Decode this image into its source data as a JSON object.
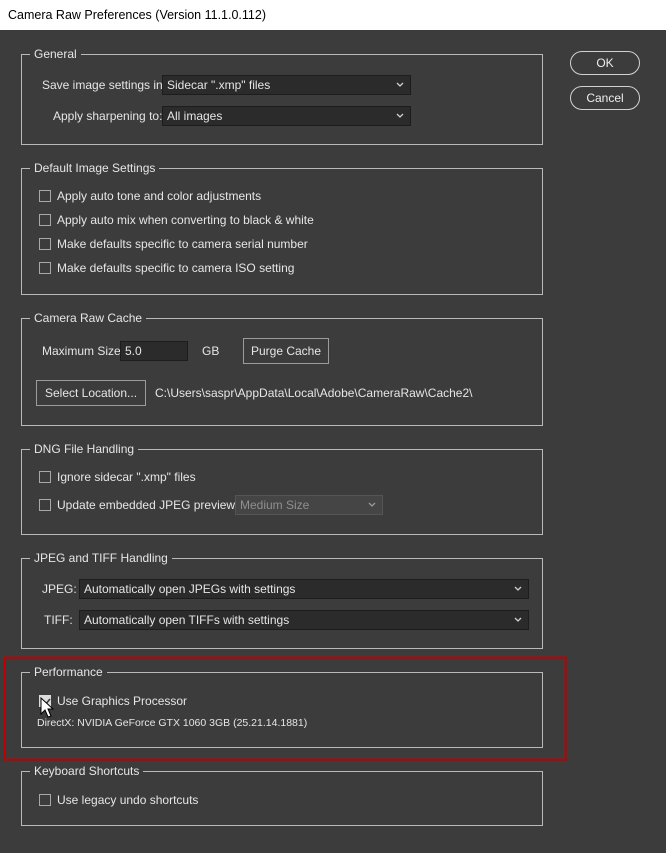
{
  "window": {
    "title": "Camera Raw Preferences  (Version 11.1.0.112)"
  },
  "buttons": {
    "ok": "OK",
    "cancel": "Cancel"
  },
  "general": {
    "legend": "General",
    "save_label": "Save image settings in:",
    "save_value": "Sidecar \".xmp\" files",
    "sharpen_label": "Apply sharpening to:",
    "sharpen_value": "All images"
  },
  "default_settings": {
    "legend": "Default Image Settings",
    "options": [
      {
        "label": "Apply auto tone and color adjustments",
        "checked": false
      },
      {
        "label": "Apply auto mix when converting to black & white",
        "checked": false
      },
      {
        "label": "Make defaults specific to camera serial number",
        "checked": false
      },
      {
        "label": "Make defaults specific to camera ISO setting",
        "checked": false
      }
    ]
  },
  "cache": {
    "legend": "Camera Raw Cache",
    "max_size_label": "Maximum Size:",
    "max_size_value": "5.0",
    "unit": "GB",
    "purge_label": "Purge Cache",
    "select_location_label": "Select Location...",
    "path": "C:\\Users\\saspr\\AppData\\Local\\Adobe\\CameraRaw\\Cache2\\"
  },
  "dng": {
    "legend": "DNG File Handling",
    "ignore_label": "Ignore sidecar \".xmp\" files",
    "update_label": "Update embedded JPEG previews:",
    "preview_value": "Medium Size"
  },
  "jpeg_tiff": {
    "legend": "JPEG and TIFF Handling",
    "jpeg_label": "JPEG:",
    "jpeg_value": "Automatically open JPEGs with settings",
    "tiff_label": "TIFF:",
    "tiff_value": "Automatically open TIFFs with settings"
  },
  "performance": {
    "legend": "Performance",
    "gpu_label": "Use Graphics Processor",
    "gpu_checked": true,
    "gpu_info": "DirectX: NVIDIA GeForce GTX 1060 3GB (25.21.14.1881)",
    "highlight_color": "#c00000"
  },
  "shortcuts": {
    "legend": "Keyboard Shortcuts",
    "undo_label": "Use legacy undo shortcuts"
  }
}
